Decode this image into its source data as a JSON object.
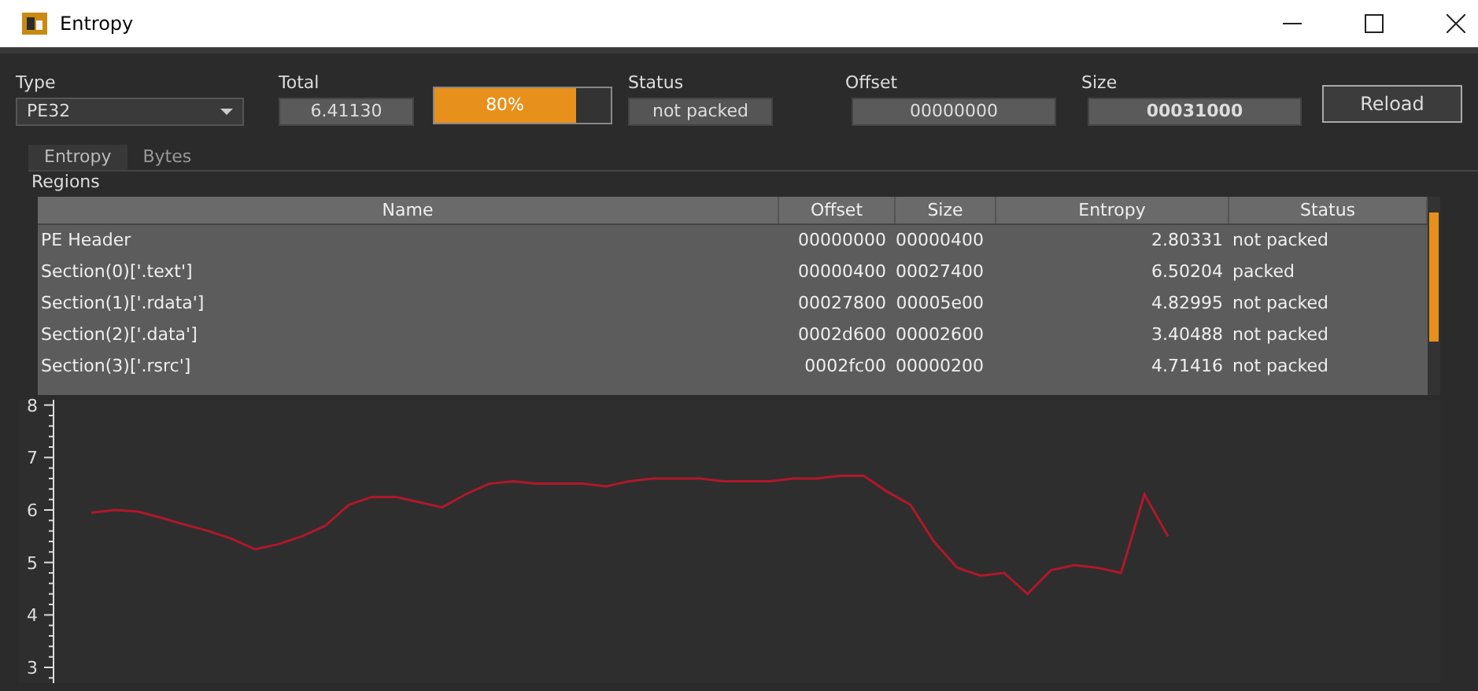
{
  "window": {
    "title": "Entropy"
  },
  "fields": {
    "type": {
      "label": "Type",
      "value": "PE32"
    },
    "total": {
      "label": "Total",
      "value": "6.41130"
    },
    "progress": {
      "level": 0.8,
      "text": "80%"
    },
    "status": {
      "label": "Status",
      "value": "not packed"
    },
    "offset": {
      "label": "Offset",
      "value": "00000000"
    },
    "size": {
      "label": "Size",
      "value": "00031000"
    }
  },
  "reload_button": "Reload",
  "tabs": [
    {
      "label": "Entropy",
      "selected": true
    },
    {
      "label": "Bytes",
      "selected": false
    }
  ],
  "regions": {
    "title": "Regions",
    "columns": [
      "Name",
      "Offset",
      "Size",
      "Entropy",
      "Status"
    ],
    "rows": [
      [
        "PE Header",
        "00000000",
        "00000400",
        "2.80331",
        "not packed"
      ],
      [
        "Section(0)['.text']",
        "00000400",
        "00027400",
        "6.50204",
        "packed"
      ],
      [
        "Section(1)['.rdata']",
        "00027800",
        "00005e00",
        "4.82995",
        "not packed"
      ],
      [
        "Section(2)['.data']",
        "0002d600",
        "00002600",
        "3.40488",
        "not packed"
      ],
      [
        "Section(3)['.rsrc']",
        "0002fc00",
        "00000200",
        "4.71416",
        "not packed"
      ]
    ]
  },
  "chart_data": {
    "type": "line",
    "ylim": [
      2.7,
      8.1
    ],
    "yticks": [
      {
        "value": 3,
        "label": "3"
      },
      {
        "value": 4,
        "label": "4"
      },
      {
        "value": 5,
        "label": "5"
      },
      {
        "value": 6,
        "label": "6"
      },
      {
        "value": 7,
        "label": "7"
      },
      {
        "value": 8,
        "label": "8"
      }
    ],
    "categories": [
      null,
      null,
      null,
      null,
      null,
      null,
      null,
      null,
      null,
      null,
      null,
      null,
      null,
      null,
      null,
      null,
      null,
      null,
      null,
      null,
      null,
      null,
      null,
      null,
      null,
      null,
      null,
      null,
      null,
      null,
      null,
      null,
      null,
      null,
      null,
      null,
      null,
      null,
      null,
      null,
      null,
      null,
      null,
      null,
      null,
      null,
      null
    ],
    "series": [
      {
        "color": "#b0182a",
        "values": [
          5.95,
          6.0,
          5.97,
          5.85,
          5.72,
          5.6,
          5.45,
          5.25,
          5.35,
          5.5,
          5.7,
          6.1,
          6.25,
          6.25,
          6.15,
          6.05,
          6.3,
          6.5,
          6.55,
          6.5,
          6.5,
          6.5,
          6.45,
          6.55,
          6.6,
          6.6,
          6.6,
          6.55,
          6.55,
          6.55,
          6.6,
          6.6,
          6.65,
          6.65,
          6.35,
          6.1,
          5.4,
          4.9,
          4.75,
          4.8,
          4.4,
          4.85,
          4.95,
          4.9,
          4.8,
          6.3,
          5.5
        ]
      }
    ]
  }
}
